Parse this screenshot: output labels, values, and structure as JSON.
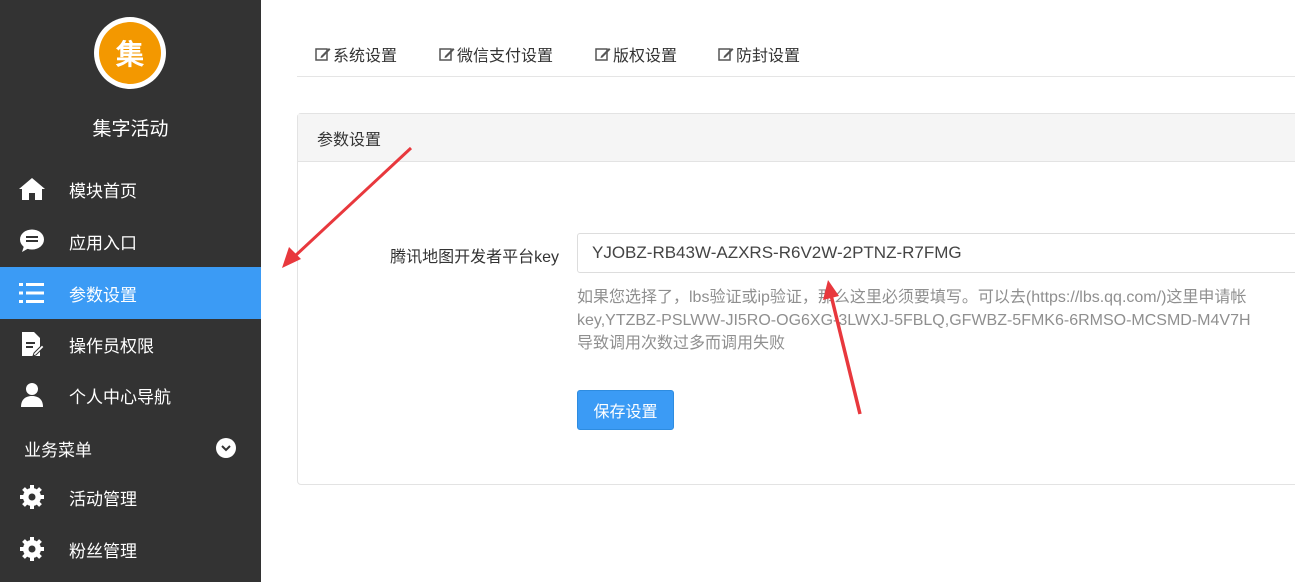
{
  "sidebar": {
    "logo_char": "集",
    "app_name": "集字活动",
    "items": [
      {
        "label": "模块首页",
        "icon": "home-icon"
      },
      {
        "label": "应用入口",
        "icon": "chat-icon"
      },
      {
        "label": "参数设置",
        "icon": "list-icon",
        "active": true
      },
      {
        "label": "操作员权限",
        "icon": "edit-document-icon"
      },
      {
        "label": "个人中心导航",
        "icon": "user-icon"
      }
    ],
    "section": {
      "label": "业务菜单",
      "icon": "chevron-down-icon"
    },
    "business_items": [
      {
        "label": "活动管理",
        "icon": "gear-icon"
      },
      {
        "label": "粉丝管理",
        "icon": "gear-icon"
      }
    ]
  },
  "tabs": [
    {
      "label": "系统设置",
      "icon": "edit-icon"
    },
    {
      "label": "微信支付设置",
      "icon": "edit-icon"
    },
    {
      "label": "版权设置",
      "icon": "edit-icon"
    },
    {
      "label": "防封设置",
      "icon": "edit-icon"
    }
  ],
  "panel": {
    "title": "参数设置",
    "field_label": "腾讯地图开发者平台key",
    "field_value": "YJOBZ-RB43W-AZXRS-R6V2W-2PTNZ-R7FMG",
    "help_lines": [
      "如果您选择了，lbs验证或ip验证，那么这里必须要填写。可以去(https://lbs.qq.com/)这里申请帐",
      "key,YTZBZ-PSLWW-JI5RO-OG6XG-3LWXJ-5FBLQ,GFWBZ-5FMK6-6RMSO-MCSMD-M4V7H",
      "导致调用次数过多而调用失败"
    ],
    "save_label": "保存设置"
  },
  "colors": {
    "sidebar_bg": "#333333",
    "active_bg": "#3b9bf5",
    "logo_bg": "#f39800",
    "button_bg": "#3b9bf5",
    "annotation_arrow": "#e8383d"
  }
}
